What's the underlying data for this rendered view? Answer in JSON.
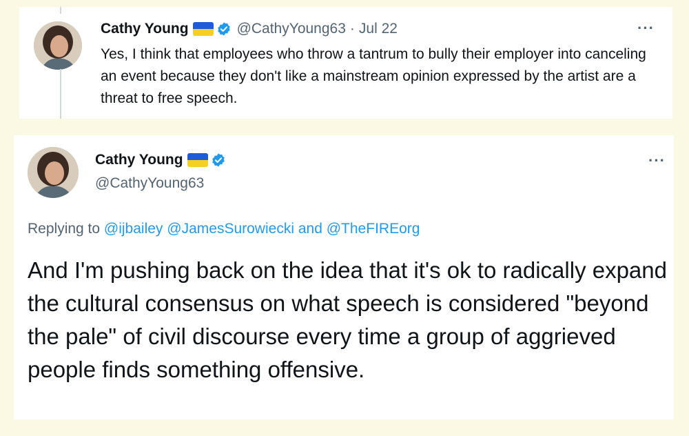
{
  "tweet1": {
    "author_name": "Cathy Young",
    "handle": "@CathyYoung63",
    "separator": "·",
    "date": "Jul 22",
    "text": "Yes, I think that employees who throw a tantrum to bully their employer into canceling an event because they don't like a mainstream opinion expressed by the artist are a threat to free speech.",
    "more_label": "···"
  },
  "tweet2": {
    "author_name": "Cathy Young",
    "handle": "@CathyYoung63",
    "more_label": "···",
    "replying_prefix": "Replying to",
    "mention1": "@ijbailey",
    "mention2": "@JamesSurowiecki",
    "conjunction": "and",
    "mention3": "@TheFIREorg",
    "text": "And I'm pushing back on the idea that it's ok to radically expand the cultural consensus on what speech is considered \"beyond the pale\" of civil discourse every time a group of aggrieved people finds something offensive."
  },
  "colors": {
    "page_background": "#fbf8e4",
    "link": "#1d9bf0",
    "secondary_text": "#536471",
    "flag_blue": "#1d5bd8",
    "flag_yellow": "#f5d020"
  },
  "icons": [
    "ukraine-flag-icon",
    "verified-badge-icon",
    "more-options-icon",
    "avatar"
  ]
}
